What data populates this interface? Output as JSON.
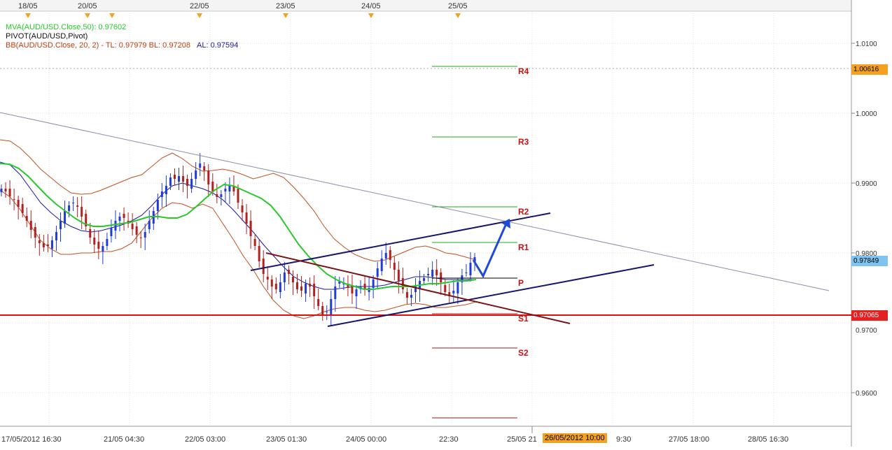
{
  "colors": {
    "grid": "#e2e2e2",
    "axis_text": "#333333",
    "candle_up": "#1f3cd8",
    "candle_down": "#b32020",
    "ma": "#27c92a",
    "bb": "#c05020",
    "bb_mid": "#1a1aa0",
    "trend_navy": "#15156b",
    "trend_brown": "#7a1414",
    "gray_trend": "#8c8ca8",
    "support": "#e01010",
    "arrow": "#1f4ad8",
    "pivot_res": "#1fa81f",
    "pivot_sup": "#b01010",
    "pivot_label": "#cc1010",
    "tag_orange": "#f4a020",
    "tag_blue": "#7ec4ee",
    "tag_red": "#e52020"
  },
  "legend": {
    "ma_text": "MVA(AUD/USD.Close,50): 0.97602",
    "pivot_text": "PIVOT(AUD/USD,Pivot)",
    "bb_text": "BB(AUD/USD.Close, 20, 2)  -  TL: 0.97979   BL: 0.97208",
    "bb_al": "AL: 0.97594"
  },
  "top_dates": [
    "18/05",
    "20/05",
    "22/05",
    "23/05",
    "24/05",
    "25/05"
  ],
  "price_axis": {
    "ticks": [
      "1.0100",
      "1.0000",
      "0.9900",
      "0.9800",
      "0.9600"
    ],
    "tag_high": "1.00616",
    "tag_last": "0.97849",
    "tag_support": "0.97065",
    "hidden_tick": "0.9700"
  },
  "time_axis": {
    "labels": [
      "17/05/2012 16:30",
      "21/05 04:30",
      "22/05 03:00",
      "23/05 01:30",
      "24/05 00:00",
      "22:30",
      "25/05 21",
      "9:30",
      "27/05 18:00",
      "28/05 16:30"
    ],
    "crosshair": "26/05/2012 10:00"
  },
  "pivots": {
    "R4": "R4",
    "R3": "R3",
    "R2": "R2",
    "R1": "R1",
    "P": "P",
    "S1": "S1",
    "S2": "S2"
  },
  "chart_data": {
    "type": "candlestick",
    "symbol": "AUD/USD",
    "ylim": [
      0.955,
      1.013
    ],
    "grid": true,
    "indicators": {
      "MVA(AUD/USD.Close,50)": 0.97602,
      "BB_TL": 0.97979,
      "BB_BL": 0.97208,
      "BB_AL": 0.97594
    },
    "pivot_levels": {
      "R4": 1.0061,
      "R3": 0.9964,
      "R2": 0.9863,
      "R1": 0.9812,
      "P": 0.9762,
      "S1": 0.971,
      "S2": 0.966,
      "S3": 0.956
    },
    "close_path": [
      0.9892,
      0.9888,
      0.9881,
      0.9876,
      0.9866,
      0.9857,
      0.9846,
      0.9833,
      0.9822,
      0.9814,
      0.9808,
      0.981,
      0.9818,
      0.983,
      0.9846,
      0.986,
      0.9868,
      0.9872,
      0.9866,
      0.9852,
      0.9838,
      0.9822,
      0.9812,
      0.9806,
      0.981,
      0.982,
      0.9836,
      0.9846,
      0.9852,
      0.985,
      0.9842,
      0.9834,
      0.9826,
      0.9822,
      0.983,
      0.9846,
      0.986,
      0.9876,
      0.9888,
      0.9896,
      0.9908,
      0.9906,
      0.991,
      0.9902,
      0.9896,
      0.9906,
      0.9918,
      0.9928,
      0.9918,
      0.9898,
      0.9888,
      0.988,
      0.9884,
      0.9892,
      0.9896,
      0.9888,
      0.9872,
      0.9858,
      0.9842,
      0.9824,
      0.981,
      0.9788,
      0.977,
      0.9762,
      0.9752,
      0.9748,
      0.9758,
      0.9772,
      0.977,
      0.9758,
      0.9748,
      0.9746,
      0.9756,
      0.9752,
      0.9738,
      0.9724,
      0.9712,
      0.9716,
      0.9734,
      0.9752,
      0.976,
      0.9756,
      0.975,
      0.9742,
      0.9748,
      0.9752,
      0.9748,
      0.975,
      0.9762,
      0.9778,
      0.9792,
      0.98,
      0.979,
      0.9776,
      0.976,
      0.9748,
      0.9736,
      0.974,
      0.9752,
      0.976,
      0.9764,
      0.977,
      0.9776,
      0.9768,
      0.9758,
      0.9744,
      0.9738,
      0.9746,
      0.9758,
      0.9768,
      0.9772,
      0.9786,
      0.9794
    ],
    "ma_path": [
      0.9928,
      0.9927,
      0.9921,
      0.991,
      0.9896,
      0.9882,
      0.987,
      0.986,
      0.985,
      0.9842,
      0.9838,
      0.9838,
      0.984,
      0.9842,
      0.9844,
      0.9848,
      0.9852,
      0.9852,
      0.985,
      0.985,
      0.9855,
      0.9866,
      0.9878,
      0.989,
      0.9898,
      0.9896,
      0.989,
      0.9884,
      0.9878,
      0.9868,
      0.9852,
      0.9832,
      0.9812,
      0.9796,
      0.9782,
      0.977,
      0.9762,
      0.9756,
      0.9752,
      0.9748,
      0.9748,
      0.975,
      0.9752,
      0.9752,
      0.9752,
      0.9754,
      0.9756,
      0.9756,
      0.9758,
      0.976,
      0.976,
      0.9762
    ],
    "bb_upper_path": [
      0.9962,
      0.996,
      0.995,
      0.9936,
      0.992,
      0.9908,
      0.9896,
      0.9886,
      0.9884,
      0.9885,
      0.989,
      0.9896,
      0.9902,
      0.9908,
      0.9912,
      0.9924,
      0.9936,
      0.9943,
      0.9935,
      0.9924,
      0.9917,
      0.9918,
      0.992,
      0.9917,
      0.9912,
      0.9906,
      0.991,
      0.9914,
      0.9908,
      0.9894,
      0.9878,
      0.986,
      0.9838,
      0.982,
      0.9808,
      0.9798,
      0.9792,
      0.9788,
      0.979,
      0.9796,
      0.9802,
      0.9808,
      0.981,
      0.9806,
      0.98,
      0.9798,
      0.9794,
      0.979
    ],
    "bb_lower_path": [
      0.989,
      0.988,
      0.9862,
      0.984,
      0.9818,
      0.9806,
      0.9798,
      0.9798,
      0.98,
      0.98,
      0.9802,
      0.9802,
      0.9806,
      0.9814,
      0.9832,
      0.985,
      0.9864,
      0.9872,
      0.987,
      0.9864,
      0.987,
      0.9864,
      0.9842,
      0.982,
      0.9796,
      0.9776,
      0.9752,
      0.9732,
      0.9718,
      0.971,
      0.9706,
      0.971,
      0.9716,
      0.972,
      0.9722,
      0.9722,
      0.9718,
      0.9716,
      0.9718,
      0.9722,
      0.9726,
      0.9728,
      0.9726,
      0.9722,
      0.9722,
      0.9724,
      0.9726,
      0.973
    ],
    "bb_mid_path": [
      0.993,
      0.9926,
      0.9912,
      0.9892,
      0.9872,
      0.9858,
      0.9846,
      0.9838,
      0.9832,
      0.983,
      0.9832,
      0.9836,
      0.984,
      0.9846,
      0.9854,
      0.9868,
      0.9884,
      0.9896,
      0.99,
      0.9896,
      0.9892,
      0.9886,
      0.9876,
      0.9862,
      0.9846,
      0.983,
      0.9812,
      0.9796,
      0.978,
      0.9766,
      0.9758,
      0.9752,
      0.9748,
      0.9748,
      0.975,
      0.9752,
      0.9752,
      0.9752,
      0.9754,
      0.9758,
      0.9762,
      0.9766,
      0.9766,
      0.9764,
      0.9762,
      0.9762,
      0.9762,
      0.9762
    ]
  }
}
